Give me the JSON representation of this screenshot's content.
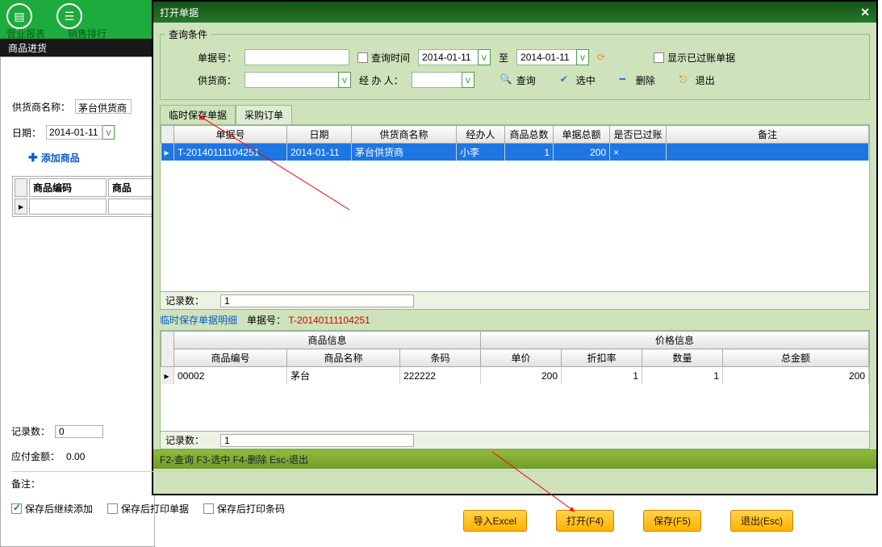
{
  "bg": {
    "btn1": "营业报表",
    "btn2": "销售排行",
    "blackbar": "商品进货"
  },
  "left": {
    "supplier_label": "供货商名称：",
    "supplier_value": "茅台供货商",
    "date_label": "日期：",
    "date_value": "2014-01-11",
    "add_product": "添加商品",
    "cols": {
      "c1": "商品编码",
      "c2": "商品"
    },
    "records_label": "记录数：",
    "records_value": "0",
    "pay_label": "应付金额：",
    "pay_value": "0.00",
    "remark_label": "备注："
  },
  "dialog": {
    "title": "打开单据",
    "legend": "查询条件",
    "docno_label": "单据号：",
    "qtime_label": "查询时间",
    "date_from": "2014-01-11",
    "date_to_label": "至",
    "date_to": "2014-01-11",
    "show_posted": "显示已过账单据",
    "supplier_label": "供货商：",
    "handler_label": "经 办 人：",
    "btn_query": "查询",
    "btn_select": "选中",
    "btn_delete": "删除",
    "btn_exit": "退出",
    "tabs": {
      "t1": "临时保存单据",
      "t2": "采购订单"
    },
    "grid_cols": {
      "c1": "单据号",
      "c2": "日期",
      "c3": "供货商名称",
      "c4": "经办人",
      "c5": "商品总数",
      "c6": "单据总额",
      "c7": "是否已过账",
      "c8": "备注"
    },
    "rows": [
      {
        "docno": "T-20140111104251",
        "date": "2014-01-11",
        "supplier": "茅台供货商",
        "handler": "小李",
        "qty": "1",
        "amount": "200",
        "posted": "×",
        "remark": ""
      }
    ],
    "records_label": "记录数：",
    "records_value": "1",
    "detail_title": "临时保存单据明细",
    "detail_docno_label": "单据号：",
    "detail_docno": "T-20140111104251",
    "g2_groups": {
      "g1": "商品信息",
      "g2": "价格信息"
    },
    "g2_cols": {
      "c1": "商品编号",
      "c2": "商品名称",
      "c3": "条码",
      "c4": "单价",
      "c5": "折扣率",
      "c6": "数量",
      "c7": "总金额"
    },
    "g2_rows": [
      {
        "code": "00002",
        "name": "茅台",
        "barcode": "222222",
        "price": "200",
        "discount": "1",
        "qty": "1",
        "total": "200"
      }
    ],
    "g2_records_value": "1",
    "hint": "F2-查询 F3-选中 F4-删除 Esc-退出"
  },
  "footer": {
    "chk1": "保存后继续添加",
    "chk2": "保存后打印单据",
    "chk3": "保存后打印条码",
    "b1": "导入Excel",
    "b2": "打开(F4)",
    "b3": "保存(F5)",
    "b4": "退出(Esc)"
  }
}
